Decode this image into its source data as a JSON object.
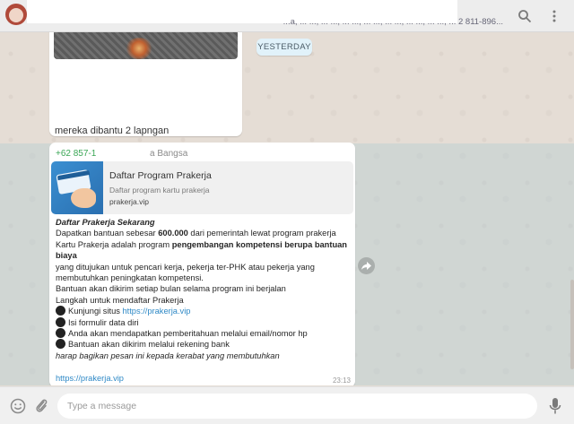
{
  "header": {
    "subtitle": "...a, ... ..., ... ..., ... ..., ... ..., ... ..., ... ..., ... ..., ... 2 811-896..."
  },
  "previous_message": {
    "caption": "mereka dibantu 2 lapngan"
  },
  "date_divider": "YESTERDAY",
  "message": {
    "sender_number": "+62 857-1",
    "sender_name": "a Bangsa",
    "preview": {
      "title": "Daftar Program Prakerja",
      "description": "Daftar program kartu prakerja",
      "domain": "prakerja.vip"
    },
    "heading": "Daftar Prakerja Sekarang",
    "line1_pre": "Dapatkan bantuan sebesar ",
    "line1_bold": "600.000",
    "line1_post": " dari pemerintah lewat program prakerja",
    "line2_pre": "Kartu Prakerja adalah program ",
    "line2_bold": "pengembangan kompetensi berupa bantuan",
    "line3_bold": "biaya",
    "line4": "yang ditujukan untuk pencari kerja, pekerja ter-PHK atau pekerja yang",
    "line5": "membutuhkan peningkatan kompetensi.",
    "line6": "Bantuan akan dikirim setiap bulan selama program ini berjalan",
    "line7": "Langkah untuk mendaftar Prakerja",
    "step1_text": "Kunjungi situs ",
    "step1_link": "https://prakerja.vip",
    "step2": "Isi formulir data diri",
    "step3": "Anda akan mendapatkan pemberitahuan melalui email/nomor hp",
    "step4": "Bantuan akan dikirim melalui rekening bank",
    "closing": "harap bagikan pesan ini kepada kerabat yang membutuhkan",
    "link": "https://prakerja.vip",
    "time": "23:13"
  },
  "composer": {
    "placeholder": "Type a message"
  },
  "icons": {
    "search": "search-icon",
    "menu": "kebab-menu-icon",
    "emoji": "smiley-icon",
    "attach": "paperclip-icon",
    "mic": "microphone-icon",
    "forward": "forward-arrow-icon"
  }
}
